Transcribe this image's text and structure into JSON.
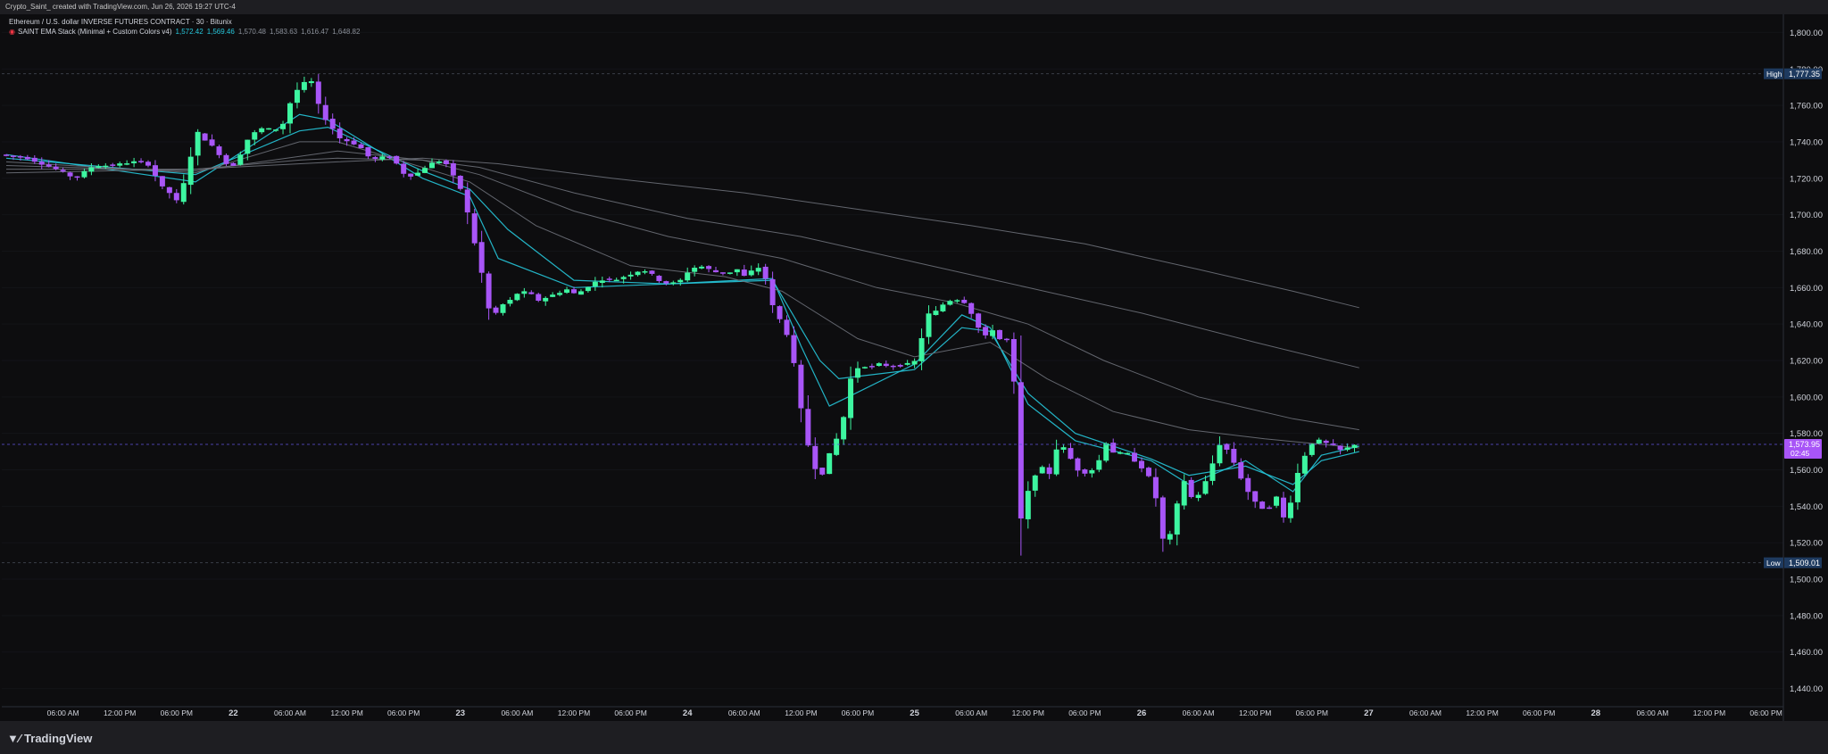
{
  "header": {
    "caption": "Crypto_Saint_ created with TradingView.com, Jun 26, 2026 19:27 UTC-4"
  },
  "legend": {
    "title": "Ethereum / U.S. dollar INVERSE FUTURES CONTRACT · 30 · Bitunix",
    "indicator": "SAINT EMA Stack (Minimal + Custom Colors v4)",
    "values": [
      {
        "text": "1,572.42",
        "color": "#26c6da"
      },
      {
        "text": "1,569.46",
        "color": "#26c6da"
      },
      {
        "text": "1,570.48",
        "color": "#8a8f98"
      },
      {
        "text": "1,583.63",
        "color": "#8a8f98"
      },
      {
        "text": "1,616.47",
        "color": "#8a8f98"
      },
      {
        "text": "1,648.82",
        "color": "#8a8f98"
      }
    ]
  },
  "logo": {
    "text": "TradingView",
    "icon": "tradingview-logo-icon"
  },
  "colors": {
    "bull": "#3df5a0",
    "bear": "#a855f7",
    "ema_fast": "#26c6da",
    "ema_slow": "#6b6f78",
    "high_tag": "#1e3a5f",
    "price_tag": "#a855f7"
  },
  "chart_data": {
    "type": "candlestick",
    "symbol": "Ethereum / U.S. dollar INVERSE FUTURES CONTRACT",
    "interval": "30",
    "exchange": "Bitunix",
    "ylim": [
      1430,
      1810
    ],
    "y_ticks": [
      1440,
      1460,
      1480,
      1500,
      1520,
      1540,
      1560,
      1580,
      1600,
      1620,
      1640,
      1660,
      1680,
      1700,
      1720,
      1740,
      1760,
      1780,
      1800
    ],
    "y_tick_labels": [
      "1,440.00",
      "1,460.00",
      "1,480.00",
      "1,500.00",
      "1,520.00",
      "1,540.00",
      "1,560.00",
      "1,580.00",
      "1,600.00",
      "1,620.00",
      "1,640.00",
      "1,660.00",
      "1,680.00",
      "1,700.00",
      "1,720.00",
      "1,740.00",
      "1,760.00",
      "1,780.00",
      "1,800.00"
    ],
    "x_ticks": [
      {
        "t": 6,
        "label": "06:00 AM",
        "bold": false
      },
      {
        "t": 12,
        "label": "12:00 PM",
        "bold": false
      },
      {
        "t": 18,
        "label": "06:00 PM",
        "bold": false
      },
      {
        "t": 24,
        "label": "22",
        "bold": true
      },
      {
        "t": 30,
        "label": "06:00 AM",
        "bold": false
      },
      {
        "t": 36,
        "label": "12:00 PM",
        "bold": false
      },
      {
        "t": 42,
        "label": "06:00 PM",
        "bold": false
      },
      {
        "t": 48,
        "label": "23",
        "bold": true
      },
      {
        "t": 54,
        "label": "06:00 AM",
        "bold": false
      },
      {
        "t": 60,
        "label": "12:00 PM",
        "bold": false
      },
      {
        "t": 66,
        "label": "06:00 PM",
        "bold": false
      },
      {
        "t": 72,
        "label": "24",
        "bold": true
      },
      {
        "t": 78,
        "label": "06:00 AM",
        "bold": false
      },
      {
        "t": 84,
        "label": "12:00 PM",
        "bold": false
      },
      {
        "t": 90,
        "label": "06:00 PM",
        "bold": false
      },
      {
        "t": 96,
        "label": "25",
        "bold": true
      },
      {
        "t": 102,
        "label": "06:00 AM",
        "bold": false
      },
      {
        "t": 108,
        "label": "12:00 PM",
        "bold": false
      },
      {
        "t": 114,
        "label": "06:00 PM",
        "bold": false
      },
      {
        "t": 120,
        "label": "26",
        "bold": true
      },
      {
        "t": 126,
        "label": "06:00 AM",
        "bold": false
      },
      {
        "t": 132,
        "label": "12:00 PM",
        "bold": false
      },
      {
        "t": 138,
        "label": "06:00 PM",
        "bold": false
      },
      {
        "t": 144,
        "label": "27",
        "bold": true
      },
      {
        "t": 150,
        "label": "06:00 AM",
        "bold": false
      },
      {
        "t": 156,
        "label": "12:00 PM",
        "bold": false
      },
      {
        "t": 162,
        "label": "06:00 PM",
        "bold": false
      },
      {
        "t": 168,
        "label": "28",
        "bold": true
      },
      {
        "t": 174,
        "label": "06:00 AM",
        "bold": false
      },
      {
        "t": 180,
        "label": "12:00 PM",
        "bold": false
      },
      {
        "t": 186,
        "label": "06:00 PM",
        "bold": false
      }
    ],
    "high": {
      "label": "High",
      "value": 1777.35,
      "text": "1,777.35"
    },
    "low": {
      "label": "Low",
      "value": 1509.01,
      "text": "1,509.01"
    },
    "last": {
      "value": 1573.95,
      "text": "1,573.95",
      "countdown": "02:45"
    },
    "price_path": [
      [
        0,
        1733
      ],
      [
        3,
        1731
      ],
      [
        6,
        1725
      ],
      [
        8,
        1720
      ],
      [
        10,
        1727
      ],
      [
        12,
        1727
      ],
      [
        14,
        1729
      ],
      [
        15,
        1729
      ],
      [
        16,
        1727
      ],
      [
        17,
        1716
      ],
      [
        18,
        1712
      ],
      [
        19,
        1706
      ],
      [
        20,
        1728
      ],
      [
        21,
        1745
      ],
      [
        22,
        1740
      ],
      [
        23,
        1735
      ],
      [
        24,
        1728
      ],
      [
        25,
        1727
      ],
      [
        26,
        1740
      ],
      [
        27,
        1745
      ],
      [
        28,
        1748
      ],
      [
        29,
        1746
      ],
      [
        30,
        1750
      ],
      [
        31,
        1765
      ],
      [
        32,
        1772
      ],
      [
        33,
        1773
      ],
      [
        34,
        1756
      ],
      [
        35,
        1749
      ],
      [
        36,
        1742
      ],
      [
        37,
        1740
      ],
      [
        38,
        1738
      ],
      [
        39,
        1732
      ],
      [
        40,
        1730
      ],
      [
        41,
        1733
      ],
      [
        42,
        1728
      ],
      [
        43,
        1721
      ],
      [
        44,
        1722
      ],
      [
        45,
        1726
      ],
      [
        46,
        1729
      ],
      [
        47,
        1730
      ],
      [
        48,
        1721
      ],
      [
        49,
        1712
      ],
      [
        50,
        1690
      ],
      [
        51,
        1668
      ],
      [
        52,
        1642
      ],
      [
        53,
        1650
      ],
      [
        54,
        1653
      ],
      [
        55,
        1658
      ],
      [
        56,
        1657
      ],
      [
        57,
        1653
      ],
      [
        58,
        1655
      ],
      [
        59,
        1657
      ],
      [
        60,
        1659
      ],
      [
        61,
        1656
      ],
      [
        62,
        1660
      ],
      [
        63,
        1663
      ],
      [
        64,
        1665
      ],
      [
        65,
        1664
      ],
      [
        66,
        1666
      ],
      [
        67,
        1668
      ],
      [
        68,
        1670
      ],
      [
        69,
        1667
      ],
      [
        70,
        1663
      ],
      [
        71,
        1662
      ],
      [
        72,
        1664
      ],
      [
        73,
        1670
      ],
      [
        74,
        1672
      ],
      [
        75,
        1670
      ],
      [
        76,
        1668
      ],
      [
        77,
        1668
      ],
      [
        78,
        1670
      ],
      [
        79,
        1665
      ],
      [
        80,
        1673
      ],
      [
        81,
        1665
      ],
      [
        82,
        1645
      ],
      [
        83,
        1640
      ],
      [
        84,
        1618
      ],
      [
        85,
        1585
      ],
      [
        86,
        1562
      ],
      [
        87,
        1558
      ],
      [
        88,
        1572
      ],
      [
        89,
        1582
      ],
      [
        90,
        1610
      ],
      [
        91,
        1618
      ],
      [
        92,
        1616
      ],
      [
        93,
        1618
      ],
      [
        94,
        1617
      ],
      [
        95,
        1617
      ],
      [
        96,
        1618
      ],
      [
        97,
        1620
      ],
      [
        98,
        1645
      ],
      [
        99,
        1647
      ],
      [
        100,
        1652
      ],
      [
        101,
        1654
      ],
      [
        102,
        1652
      ],
      [
        103,
        1644
      ],
      [
        104,
        1632
      ],
      [
        105,
        1637
      ],
      [
        106,
        1630
      ],
      [
        107,
        1633
      ],
      [
        108,
        1533
      ],
      [
        109,
        1553
      ],
      [
        110,
        1562
      ],
      [
        111,
        1558
      ],
      [
        112,
        1576
      ],
      [
        113,
        1568
      ],
      [
        114,
        1560
      ],
      [
        115,
        1558
      ],
      [
        116,
        1562
      ],
      [
        117,
        1575
      ],
      [
        118,
        1568
      ],
      [
        119,
        1570
      ],
      [
        120,
        1565
      ],
      [
        121,
        1560
      ],
      [
        122,
        1552
      ],
      [
        123,
        1522
      ],
      [
        124,
        1525
      ],
      [
        125,
        1557
      ],
      [
        126,
        1545
      ],
      [
        127,
        1547
      ],
      [
        128,
        1560
      ],
      [
        129,
        1574
      ],
      [
        130,
        1570
      ],
      [
        131,
        1558
      ],
      [
        132,
        1548
      ],
      [
        133,
        1540
      ],
      [
        134,
        1538
      ],
      [
        135,
        1545
      ],
      [
        136,
        1530
      ],
      [
        137,
        1555
      ],
      [
        138,
        1568
      ],
      [
        139,
        1577
      ],
      [
        140,
        1575
      ],
      [
        141,
        1573
      ],
      [
        142,
        1570
      ],
      [
        143,
        1574
      ]
    ],
    "ema_series": [
      {
        "name": "EMA 1",
        "color": "#26c6da",
        "points": [
          [
            0,
            1733
          ],
          [
            20,
            1718
          ],
          [
            31,
            1755
          ],
          [
            34,
            1752
          ],
          [
            44,
            1720
          ],
          [
            49,
            1710
          ],
          [
            52,
            1676
          ],
          [
            60,
            1660
          ],
          [
            70,
            1662
          ],
          [
            81,
            1665
          ],
          [
            84,
            1628
          ],
          [
            87,
            1595
          ],
          [
            89,
            1600
          ],
          [
            96,
            1618
          ],
          [
            101,
            1645
          ],
          [
            104,
            1638
          ],
          [
            108,
            1596
          ],
          [
            113,
            1576
          ],
          [
            121,
            1565
          ],
          [
            125,
            1552
          ],
          [
            131,
            1565
          ],
          [
            136,
            1548
          ],
          [
            139,
            1568
          ],
          [
            143,
            1573
          ]
        ]
      },
      {
        "name": "EMA 2",
        "color": "#26c6da",
        "points": [
          [
            0,
            1731
          ],
          [
            20,
            1722
          ],
          [
            31,
            1746
          ],
          [
            34,
            1748
          ],
          [
            44,
            1724
          ],
          [
            49,
            1714
          ],
          [
            53,
            1692
          ],
          [
            60,
            1664
          ],
          [
            70,
            1662
          ],
          [
            81,
            1664
          ],
          [
            86,
            1620
          ],
          [
            88,
            1610
          ],
          [
            96,
            1615
          ],
          [
            101,
            1638
          ],
          [
            104,
            1636
          ],
          [
            108,
            1602
          ],
          [
            113,
            1580
          ],
          [
            121,
            1566
          ],
          [
            125,
            1557
          ],
          [
            131,
            1562
          ],
          [
            136,
            1552
          ],
          [
            139,
            1565
          ],
          [
            143,
            1570
          ]
        ]
      },
      {
        "name": "EMA 3",
        "color": "#6b6f78",
        "points": [
          [
            0,
            1729
          ],
          [
            20,
            1723
          ],
          [
            31,
            1740
          ],
          [
            35,
            1740
          ],
          [
            44,
            1726
          ],
          [
            49,
            1718
          ],
          [
            56,
            1694
          ],
          [
            66,
            1672
          ],
          [
            76,
            1666
          ],
          [
            82,
            1658
          ],
          [
            90,
            1632
          ],
          [
            96,
            1622
          ],
          [
            104,
            1630
          ],
          [
            110,
            1610
          ],
          [
            117,
            1592
          ],
          [
            125,
            1582
          ],
          [
            133,
            1577
          ],
          [
            143,
            1572
          ]
        ]
      },
      {
        "name": "EMA 4",
        "color": "#6b6f78",
        "points": [
          [
            0,
            1727
          ],
          [
            20,
            1724
          ],
          [
            31,
            1732
          ],
          [
            35,
            1735
          ],
          [
            44,
            1730
          ],
          [
            50,
            1722
          ],
          [
            60,
            1702
          ],
          [
            70,
            1688
          ],
          [
            82,
            1676
          ],
          [
            92,
            1660
          ],
          [
            100,
            1652
          ],
          [
            108,
            1640
          ],
          [
            116,
            1620
          ],
          [
            126,
            1600
          ],
          [
            136,
            1588
          ],
          [
            143,
            1582
          ]
        ]
      },
      {
        "name": "EMA 5",
        "color": "#6b6f78",
        "points": [
          [
            0,
            1725
          ],
          [
            20,
            1725
          ],
          [
            31,
            1730
          ],
          [
            35,
            1731
          ],
          [
            44,
            1730
          ],
          [
            50,
            1726
          ],
          [
            60,
            1712
          ],
          [
            72,
            1698
          ],
          [
            84,
            1688
          ],
          [
            96,
            1674
          ],
          [
            108,
            1660
          ],
          [
            120,
            1646
          ],
          [
            132,
            1630
          ],
          [
            143,
            1616
          ]
        ]
      },
      {
        "name": "EMA 6",
        "color": "#6b6f78",
        "points": [
          [
            0,
            1723
          ],
          [
            20,
            1725
          ],
          [
            35,
            1729
          ],
          [
            44,
            1731
          ],
          [
            52,
            1728
          ],
          [
            64,
            1720
          ],
          [
            78,
            1712
          ],
          [
            90,
            1703
          ],
          [
            102,
            1694
          ],
          [
            114,
            1684
          ],
          [
            126,
            1670
          ],
          [
            136,
            1658
          ],
          [
            143,
            1649
          ]
        ]
      }
    ]
  }
}
